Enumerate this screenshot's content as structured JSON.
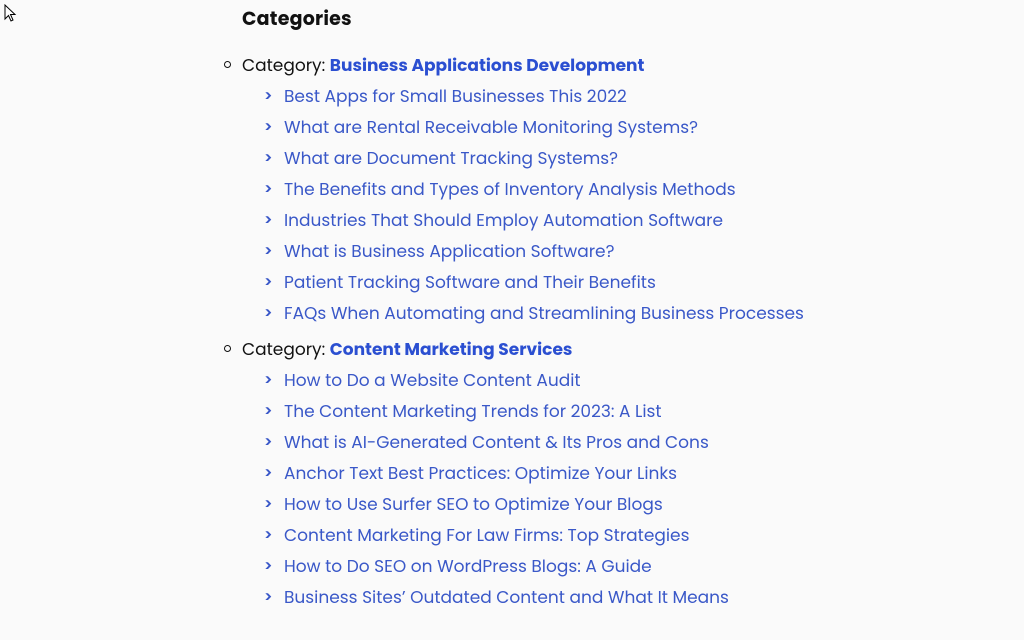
{
  "heading": "Categories",
  "category_prefix": "Category: ",
  "chevron": ">",
  "categories": [
    {
      "name": "Business Applications Development",
      "posts": [
        "Best Apps for Small Businesses This 2022",
        "What are Rental Receivable Monitoring Systems?",
        "What are Document Tracking Systems?",
        "The Benefits and Types of Inventory Analysis Methods",
        "Industries That Should Employ Automation Software",
        "What is Business Application Software?",
        "Patient Tracking Software and Their Benefits",
        "FAQs When Automating and Streamlining Business Processes"
      ]
    },
    {
      "name": "Content Marketing Services",
      "posts": [
        "How to Do a Website Content Audit",
        "The Content Marketing Trends for 2023: A List",
        "What is AI-Generated Content & Its Pros and Cons",
        "Anchor Text Best Practices: Optimize Your Links",
        "How to Use Surfer SEO to Optimize Your Blogs",
        "Content Marketing For Law Firms: Top Strategies",
        "How to Do SEO on WordPress Blogs: A Guide",
        "Business Sites’ Outdated Content and What It Means"
      ]
    }
  ]
}
